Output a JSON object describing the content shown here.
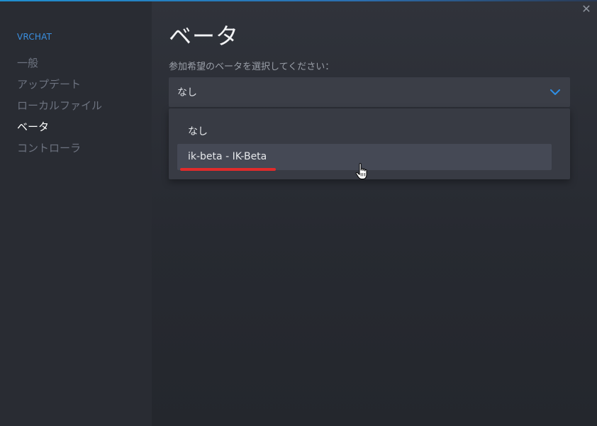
{
  "app": {
    "name": "VRCHAT"
  },
  "sidebar": {
    "items": [
      {
        "label": "一般",
        "active": false
      },
      {
        "label": "アップデート",
        "active": false
      },
      {
        "label": "ローカルファイル",
        "active": false
      },
      {
        "label": "ベータ",
        "active": true
      },
      {
        "label": "コントローラ",
        "active": false
      }
    ]
  },
  "page": {
    "title": "ベータ",
    "prompt": "参加希望のベータを選択してください："
  },
  "beta_select": {
    "selected": "なし",
    "options": [
      {
        "label": "なし",
        "hovered": false
      },
      {
        "label": "ik-beta - IK-Beta",
        "hovered": true
      }
    ]
  },
  "window": {
    "close_glyph": "✕"
  },
  "colors": {
    "accent": "#3a8fe0",
    "annotation_underline": "#e02b2b",
    "sidebar_bg": "#292c33",
    "main_bg": "#30333b"
  },
  "icons": [
    "close-icon",
    "chevron-down-icon",
    "hand-pointer-cursor-icon"
  ]
}
